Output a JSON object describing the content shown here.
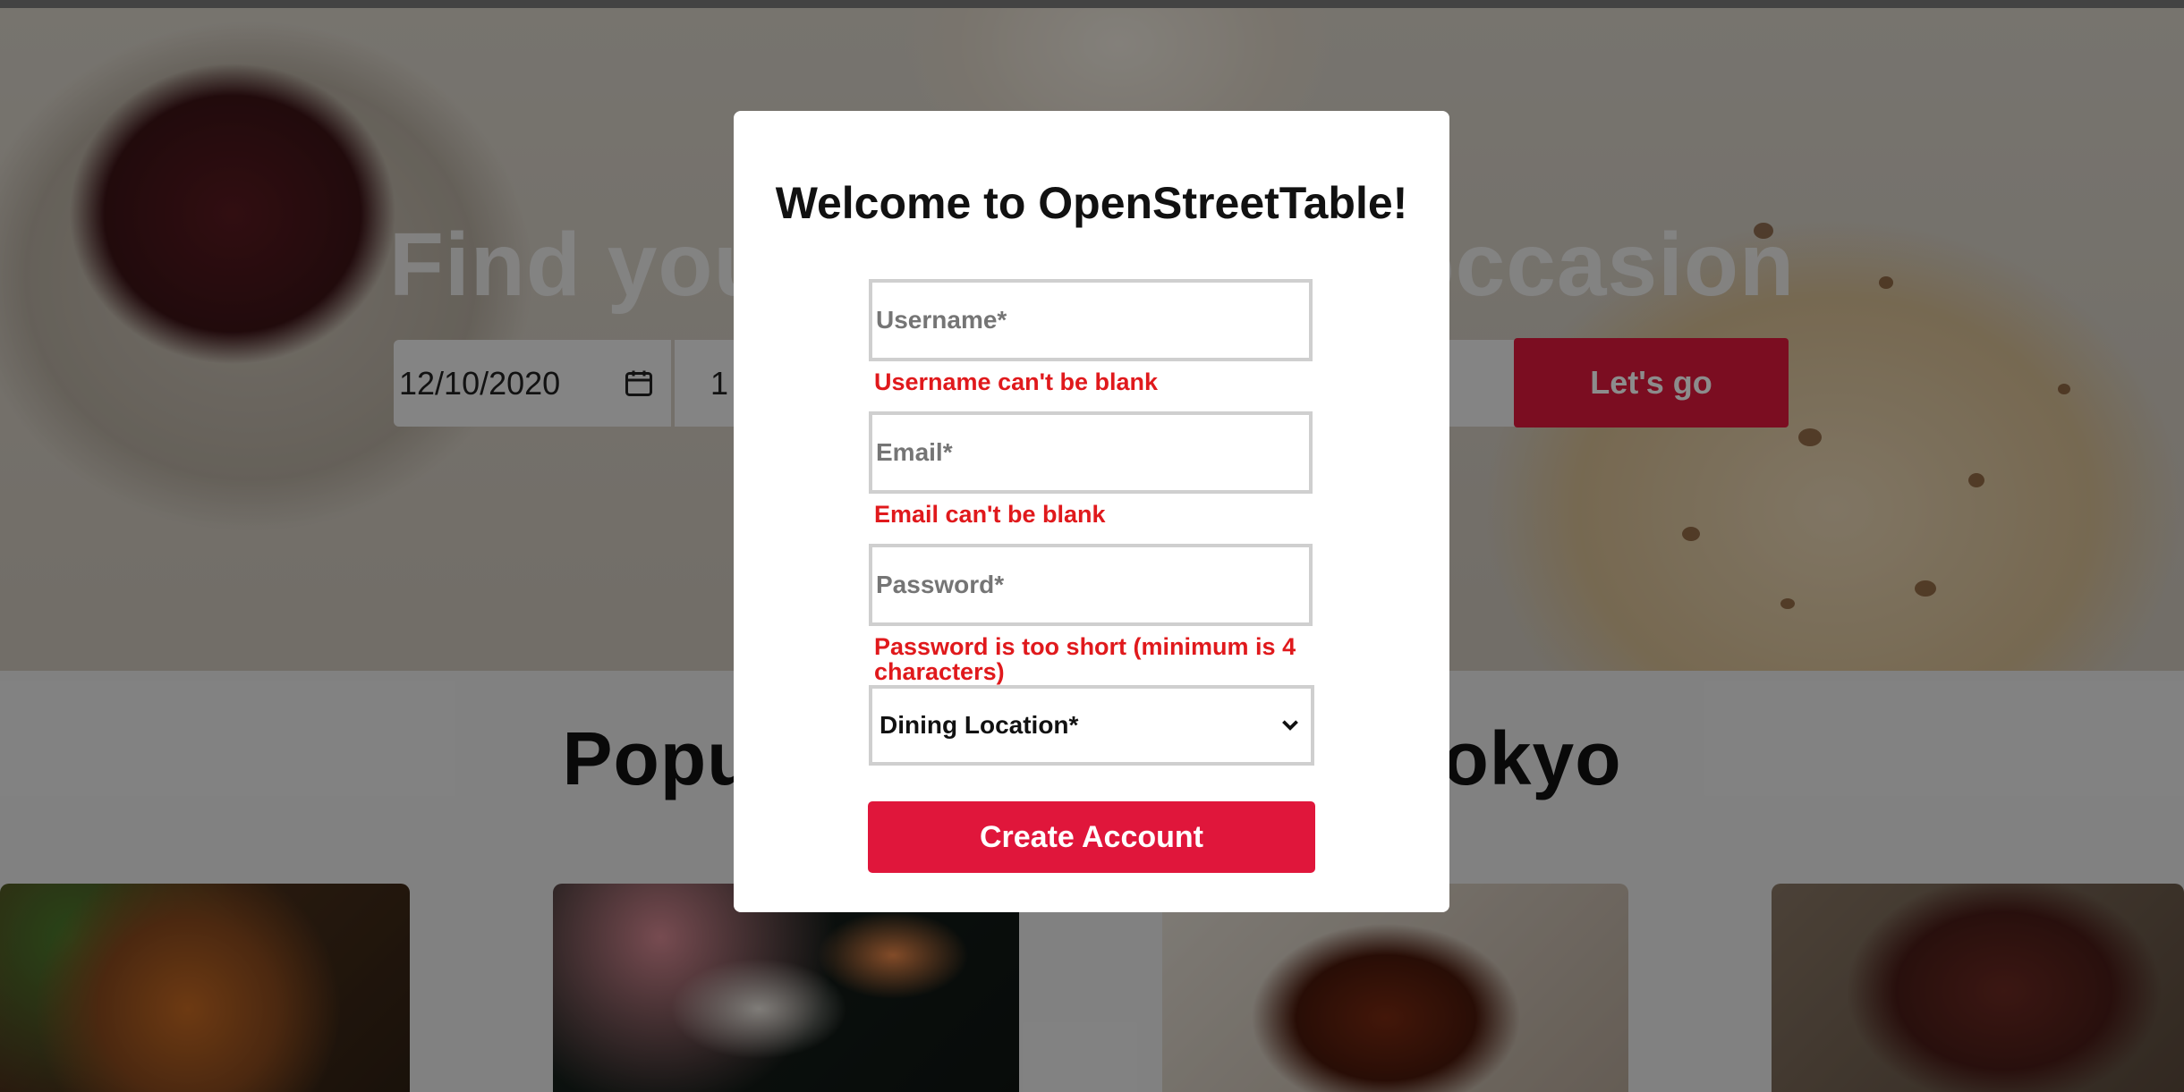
{
  "hero": {
    "title": "Find your table for any occasion",
    "date_value": "12/10/2020",
    "time_value": "1",
    "cta_label": "Let's go"
  },
  "section": {
    "title": "Popular restaurants in Tokyo"
  },
  "modal": {
    "title": "Welcome to OpenStreetTable!",
    "username": {
      "placeholder": "Username*",
      "error": "Username can't be blank"
    },
    "email": {
      "placeholder": "Email*",
      "error": "Email can't be blank"
    },
    "password": {
      "placeholder": "Password*",
      "error": "Password is too short (minimum is 4 characters)"
    },
    "dining_location": {
      "selected": "Dining Location*"
    },
    "submit_label": "Create Account"
  },
  "colors": {
    "brand_red": "#e0163b",
    "error_red": "#e0191c",
    "overlay": "rgba(0,0,0,0.45)"
  },
  "icons": [
    "calendar-icon",
    "chevron-down-icon"
  ]
}
